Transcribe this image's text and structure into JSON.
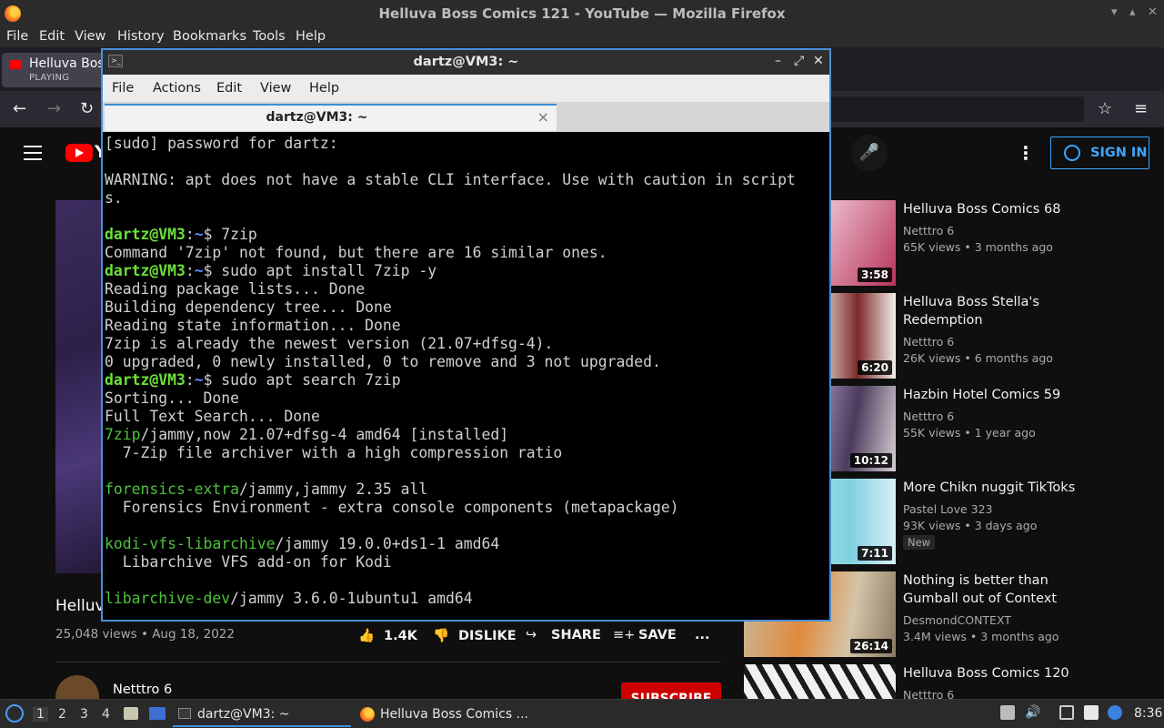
{
  "firefox": {
    "window_title": "Helluva Boss Comics 121 - YouTube — Mozilla Firefox",
    "menu": [
      "File",
      "Edit",
      "View",
      "History",
      "Bookmarks",
      "Tools",
      "Help"
    ],
    "tab": {
      "title": "Helluva Boss",
      "status": "PLAYING"
    }
  },
  "youtube": {
    "logo_text": "Y",
    "sign_in": "SIGN IN",
    "video": {
      "title": "Helluv",
      "views": "25,048 views • Aug 18, 2022",
      "like_count": "1.4K",
      "dislike": "DISLIKE",
      "share": "SHARE",
      "save": "SAVE",
      "more": "..."
    },
    "channel": {
      "name": "Netttro 6",
      "subscribe": "SUBSCRIBE"
    },
    "recommendations": [
      {
        "title": "Helluva Boss Comics 68",
        "channel": "Netttro 6",
        "meta": "65K views • 3 months ago",
        "duration": "3:58",
        "badge": ""
      },
      {
        "title": "Helluva Boss Stella's Redemption",
        "channel": "Netttro 6",
        "meta": "26K views • 6 months ago",
        "duration": "6:20",
        "badge": ""
      },
      {
        "title": "Hazbin Hotel Comics 59",
        "channel": "Netttro 6",
        "meta": "55K views • 1 year ago",
        "duration": "10:12",
        "badge": ""
      },
      {
        "title": "More Chikn nuggit TikToks",
        "channel": "Pastel Love 323",
        "meta": "93K views • 3 days ago",
        "duration": "7:11",
        "badge": "New"
      },
      {
        "title": "Nothing is better than Gumball out of Context",
        "channel": "DesmondCONTEXT",
        "meta": "3.4M views • 3 months ago",
        "duration": "26:14",
        "badge": ""
      },
      {
        "title": "Helluva Boss Comics 120",
        "channel": "Netttro 6",
        "meta": "",
        "duration": "",
        "badge": ""
      }
    ]
  },
  "terminal": {
    "window_title": "dartz@VM3: ~",
    "menu": [
      "File",
      "Actions",
      "Edit",
      "View",
      "Help"
    ],
    "tab_title": "dartz@VM3: ~",
    "lines": [
      [
        {
          "t": "[sudo] password for dartz:"
        }
      ],
      [],
      [
        {
          "t": "WARNING: apt does not have a stable CLI interface. Use with caution in script"
        }
      ],
      [
        {
          "t": "s."
        }
      ],
      [],
      [
        {
          "t": "dartz@VM3",
          "c": "user"
        },
        {
          "t": ":"
        },
        {
          "t": "~",
          "c": "path"
        },
        {
          "t": "$ 7zip"
        }
      ],
      [
        {
          "t": "Command '7zip' not found, but there are 16 similar ones."
        }
      ],
      [
        {
          "t": "dartz@VM3",
          "c": "user"
        },
        {
          "t": ":"
        },
        {
          "t": "~",
          "c": "path"
        },
        {
          "t": "$ sudo apt install 7zip -y"
        }
      ],
      [
        {
          "t": "Reading package lists... Done"
        }
      ],
      [
        {
          "t": "Building dependency tree... Done"
        }
      ],
      [
        {
          "t": "Reading state information... Done"
        }
      ],
      [
        {
          "t": "7zip is already the newest version (21.07+dfsg-4)."
        }
      ],
      [
        {
          "t": "0 upgraded, 0 newly installed, 0 to remove and 3 not upgraded."
        }
      ],
      [
        {
          "t": "dartz@VM3",
          "c": "user"
        },
        {
          "t": ":"
        },
        {
          "t": "~",
          "c": "path"
        },
        {
          "t": "$ sudo apt search 7zip"
        }
      ],
      [
        {
          "t": "Sorting... Done"
        }
      ],
      [
        {
          "t": "Full Text Search... Done"
        }
      ],
      [
        {
          "t": "7zip",
          "c": "pkg"
        },
        {
          "t": "/jammy,now 21.07+dfsg-4 amd64 [installed]"
        }
      ],
      [
        {
          "t": "  7-Zip file archiver with a high compression ratio"
        }
      ],
      [],
      [
        {
          "t": "forensics-extra",
          "c": "pkg"
        },
        {
          "t": "/jammy,jammy 2.35 all"
        }
      ],
      [
        {
          "t": "  Forensics Environment - extra console components (metapackage)"
        }
      ],
      [],
      [
        {
          "t": "kodi-vfs-libarchive",
          "c": "pkg"
        },
        {
          "t": "/jammy 19.0.0+ds1-1 amd64"
        }
      ],
      [
        {
          "t": "  Libarchive VFS add-on for Kodi"
        }
      ],
      [],
      [
        {
          "t": "libarchive-dev",
          "c": "pkg"
        },
        {
          "t": "/jammy 3.6.0-1ubuntu1 amd64"
        }
      ]
    ]
  },
  "taskbar": {
    "workspaces": [
      "1",
      "2",
      "3",
      "4"
    ],
    "tasks": [
      {
        "label": "dartz@VM3: ~"
      },
      {
        "label": "Helluva Boss Comics ..."
      }
    ],
    "clock": "8:36"
  },
  "colors": {
    "terminal_user": "#6ce03a",
    "terminal_path": "#5c8cff",
    "terminal_pkg": "#4ec23a",
    "youtube_red": "#ff0000",
    "sign_in_blue": "#3ea6ff"
  }
}
